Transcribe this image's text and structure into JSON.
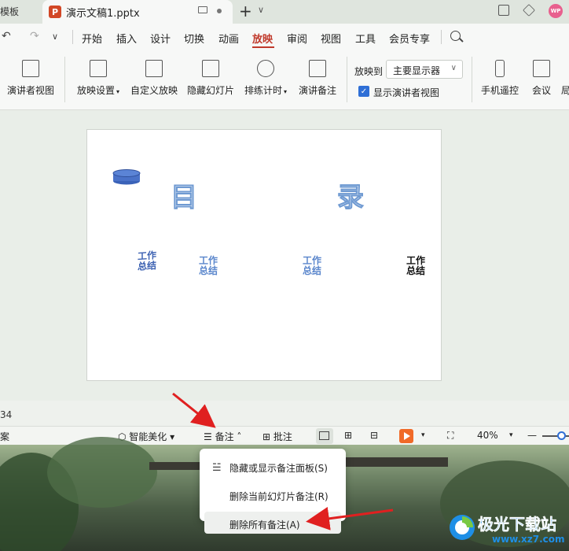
{
  "tabs": {
    "prev_tab_label": "模板",
    "active_tab_title": "演示文稿1.pptx",
    "avatar_text": "WP"
  },
  "menu": {
    "items": [
      "开始",
      "插入",
      "设计",
      "切换",
      "动画",
      "放映",
      "审阅",
      "视图",
      "工具",
      "会员专享"
    ],
    "active": "放映"
  },
  "ribbon": {
    "presenter_view": "演讲者视图",
    "slideshow_settings": "放映设置",
    "custom_show": "自定义放映",
    "hide_slide": "隐藏幻灯片",
    "rehearse_timing": "排练计时",
    "presenter_notes": "演讲备注",
    "show_to_label": "放映到",
    "show_to_value": "主要显示器",
    "show_presenter_view_checkbox": "显示演讲者视图",
    "show_presenter_view_checked": true,
    "phone_remote": "手机遥控",
    "meeting": "会议",
    "partial_label": "局"
  },
  "slide": {
    "title_left": "目",
    "title_right": "录",
    "items": [
      "工作\n总结",
      "工作\n总结",
      "工作\n总结",
      "工作\n总结"
    ]
  },
  "status": {
    "left_label": "案",
    "smart_beautify": "智能美化",
    "notes": "备注",
    "comments": "批注",
    "zoom": "40%",
    "slide_number_partial": "34"
  },
  "notes_menu": {
    "items": [
      "隐藏或显示备注面板(S)",
      "删除当前幻灯片备注(R)",
      "删除所有备注(A)"
    ],
    "highlighted_index": 2
  },
  "watermark": {
    "text": "极光下载站",
    "url": "www.xz7.com"
  },
  "colors": {
    "accent_red": "#c0392b",
    "arrow_red": "#e02020",
    "checkbox_blue": "#2f6fd6",
    "play_orange": "#f06a28"
  }
}
